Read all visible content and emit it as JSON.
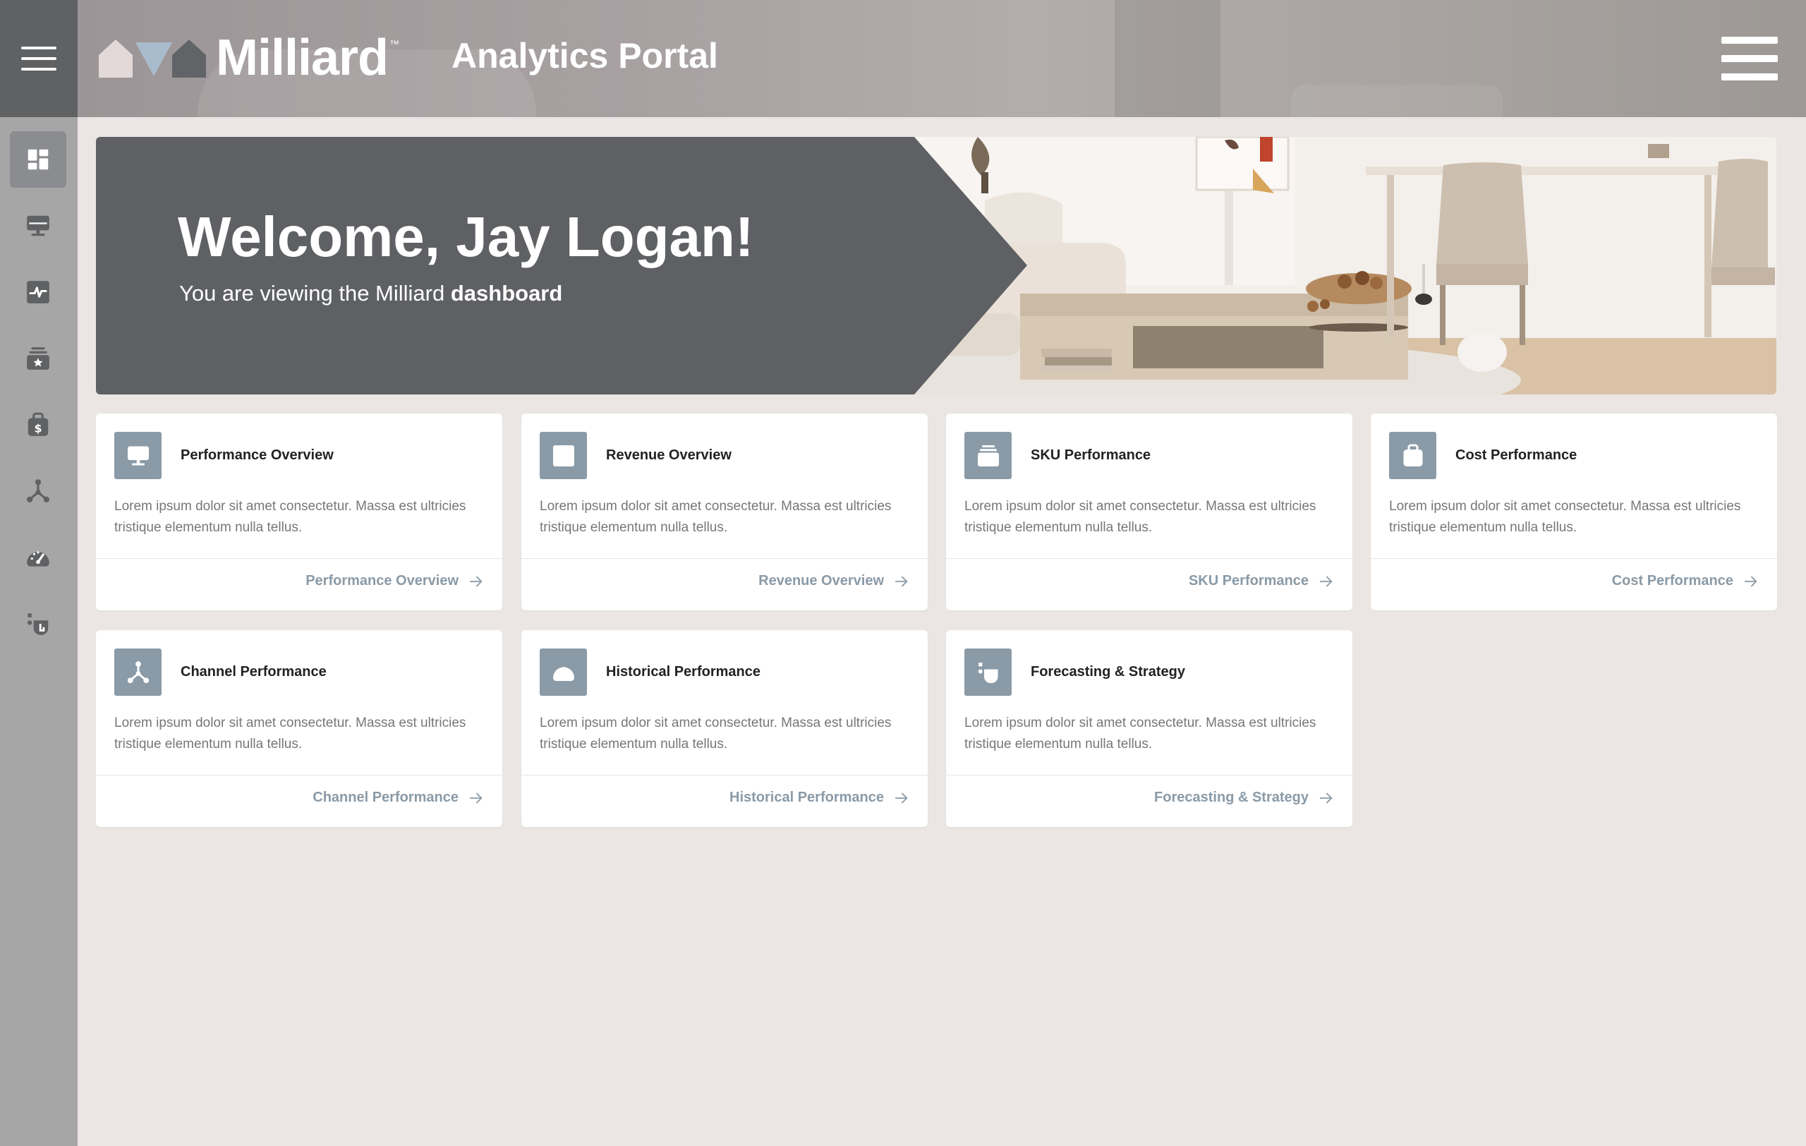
{
  "header": {
    "brand": "Milliard",
    "brand_tm": "™",
    "portal_title": "Analytics Portal"
  },
  "rail": {
    "items": [
      {
        "icon": "dashboard-icon",
        "active": true
      },
      {
        "icon": "monitor-icon",
        "active": false
      },
      {
        "icon": "pulse-chart-icon",
        "active": false
      },
      {
        "icon": "archive-star-icon",
        "active": false
      },
      {
        "icon": "money-bag-icon",
        "active": false
      },
      {
        "icon": "network-nodes-icon",
        "active": false
      },
      {
        "icon": "speedometer-icon",
        "active": false
      },
      {
        "icon": "strategy-icon",
        "active": false
      }
    ]
  },
  "hero": {
    "title": "Welcome, Jay Logan!",
    "subtitle_prefix": "You are viewing the Milliard ",
    "subtitle_bold": "dashboard"
  },
  "cards": [
    {
      "title": "Performance Overview",
      "desc": "Lorem ipsum dolor sit amet consectetur. Massa est ultricies tristique elementum nulla tellus.",
      "link": "Performance Overview",
      "icon": "monitor-icon"
    },
    {
      "title": "Revenue Overview",
      "desc": "Lorem ipsum dolor sit amet consectetur. Massa est ultricies tristique elementum nulla tellus.",
      "link": "Revenue Overview",
      "icon": "pulse-chart-icon"
    },
    {
      "title": "SKU Performance",
      "desc": "Lorem ipsum dolor sit amet consectetur. Massa est ultricies tristique elementum nulla tellus.",
      "link": "SKU Performance",
      "icon": "archive-star-icon"
    },
    {
      "title": "Cost Performance",
      "desc": "Lorem ipsum dolor sit amet consectetur. Massa est ultricies tristique elementum nulla tellus.",
      "link": "Cost Performance",
      "icon": "money-bag-icon"
    },
    {
      "title": "Channel Performance",
      "desc": "Lorem ipsum dolor sit amet consectetur. Massa est ultricies tristique elementum nulla tellus.",
      "link": "Channel Performance",
      "icon": "network-nodes-icon"
    },
    {
      "title": "Historical Performance",
      "desc": "Lorem ipsum dolor sit amet consectetur. Massa est ultricies tristique elementum nulla tellus.",
      "link": "Historical Performance",
      "icon": "speedometer-icon"
    },
    {
      "title": "Forecasting & Strategy",
      "desc": "Lorem ipsum dolor sit amet consectetur. Massa est ultricies tristique elementum nulla tellus.",
      "link": "Forecasting & Strategy",
      "icon": "strategy-icon"
    }
  ],
  "colors": {
    "rail": "#a7a6a7",
    "rail_top": "#5f6163",
    "hero_panel": "#5e6063",
    "accent": "#8a9aa7",
    "background": "#ebe6e3"
  }
}
